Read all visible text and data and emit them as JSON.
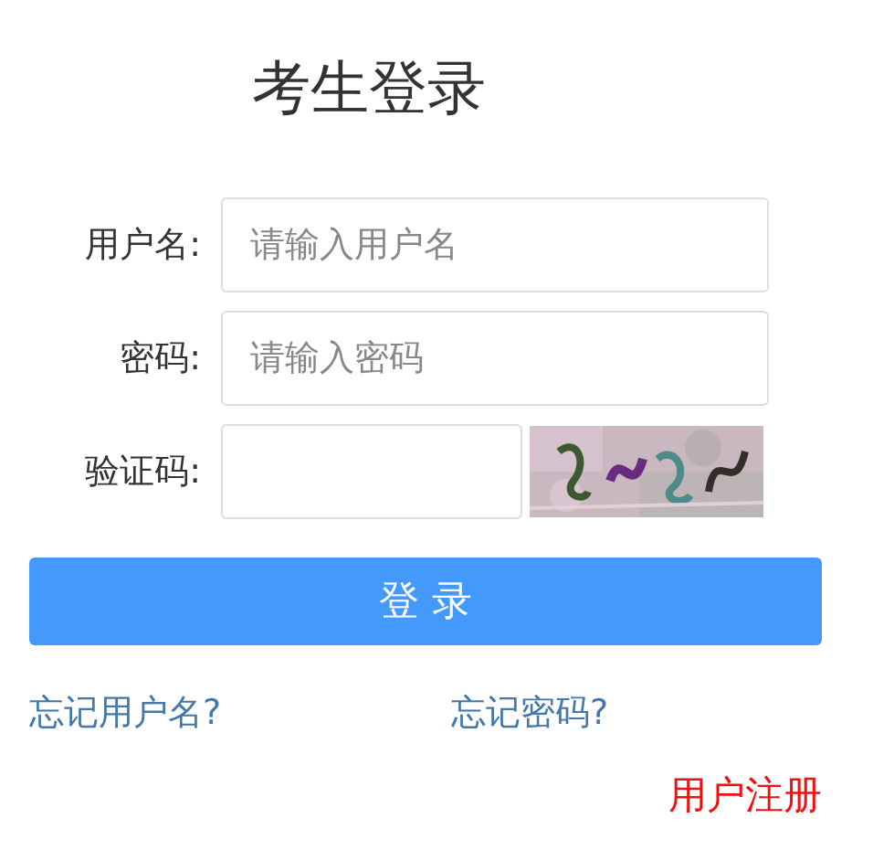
{
  "title": "考生登录",
  "fields": [
    {
      "kind": "text",
      "label": "用户名:",
      "placeholder": "请输入用户名"
    },
    {
      "kind": "text",
      "label": "密码:",
      "placeholder": "请输入密码"
    },
    {
      "kind": "captcha",
      "label": "验证码:"
    }
  ],
  "login_button": "登 录",
  "links": [
    "忘记用户名?",
    "忘记密码?"
  ],
  "register_link": "用户注册"
}
